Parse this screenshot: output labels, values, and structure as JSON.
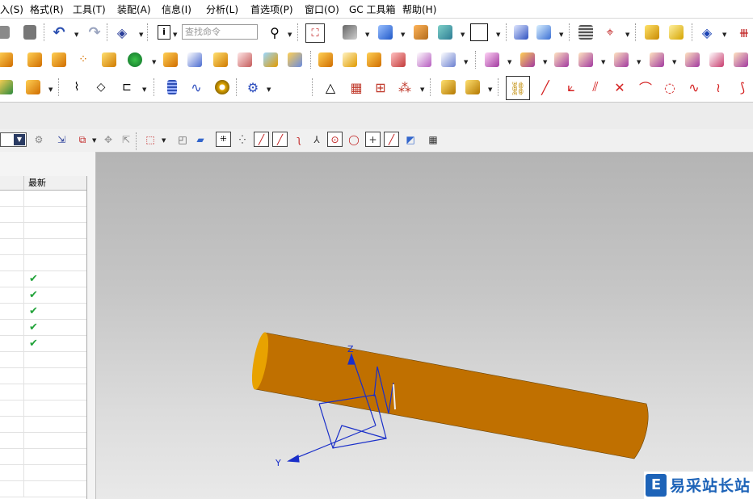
{
  "menubar": {
    "items": [
      {
        "text": "入(S)"
      },
      {
        "text": "格式(R)"
      },
      {
        "text": "工具(T)"
      },
      {
        "text": "装配(A)"
      },
      {
        "text": "信息(I)"
      },
      {
        "text": "分析(L)"
      },
      {
        "text": "首选项(P)"
      },
      {
        "text": "窗口(O)"
      },
      {
        "text": "GC 工具箱"
      },
      {
        "text": "帮助(H)"
      }
    ]
  },
  "toolbar": {
    "search_placeholder": "查找命令"
  },
  "navigator": {
    "col_latest": "最新",
    "rows": [
      {
        "latest": ""
      },
      {
        "latest": ""
      },
      {
        "latest": ""
      },
      {
        "latest": ""
      },
      {
        "latest": ""
      },
      {
        "latest": "✔"
      },
      {
        "latest": "✔"
      },
      {
        "latest": "✔"
      },
      {
        "latest": "✔"
      },
      {
        "latest": "✔"
      },
      {
        "latest": ""
      },
      {
        "latest": ""
      },
      {
        "latest": ""
      },
      {
        "latest": ""
      },
      {
        "latest": ""
      },
      {
        "latest": ""
      },
      {
        "latest": ""
      },
      {
        "latest": ""
      },
      {
        "latest": ""
      }
    ]
  },
  "viewport": {
    "axis_z": "Z",
    "axis_y": "Y"
  },
  "watermark": {
    "text": "易采站长站",
    "logo_letter": "E"
  },
  "colors": {
    "cylinder_top": "#ffd21a",
    "cylinder_mid": "#f5a800",
    "cylinder_bottom": "#c07000",
    "sketch_blue": "#1a2fc9",
    "accent_blue": "#1d63b8",
    "check_green": "#22a33a"
  }
}
